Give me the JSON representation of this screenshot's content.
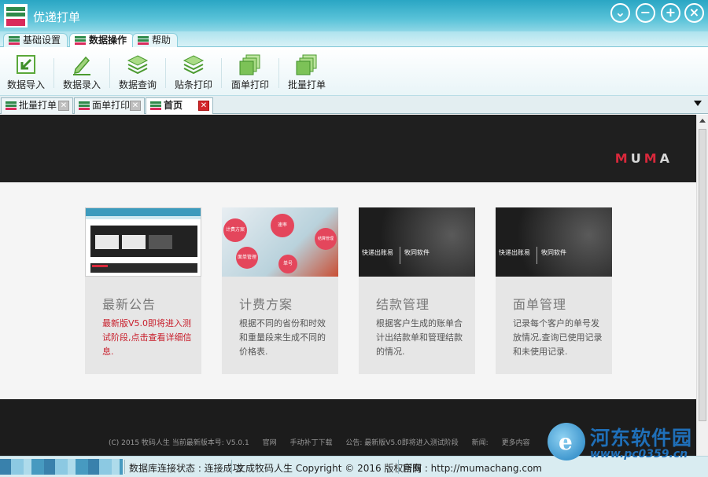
{
  "window": {
    "title": "优递打单"
  },
  "ribbon_tabs": [
    {
      "label": "基础设置"
    },
    {
      "label": "数据操作",
      "active": true
    },
    {
      "label": "帮助"
    }
  ],
  "toolbar": [
    {
      "label": "数据导入",
      "icon": "import-icon"
    },
    {
      "label": "数据录入",
      "icon": "pencil-icon"
    },
    {
      "label": "数据查询",
      "icon": "stack-icon"
    },
    {
      "label": "贴条打印",
      "icon": "stack-icon"
    },
    {
      "label": "面单打印",
      "icon": "pages-icon"
    },
    {
      "label": "批量打单",
      "icon": "pages-icon"
    }
  ],
  "doc_tabs": [
    {
      "label": "批量打单"
    },
    {
      "label": "面单打印"
    },
    {
      "label": "首页",
      "active": true
    }
  ],
  "banner": {
    "logo_text": "MUMA"
  },
  "cards": [
    {
      "title": "最新公告",
      "desc": "最新版V5.0即将进入测试阶段,点击查看详细信息.",
      "highlight": true
    },
    {
      "title": "计费方案",
      "desc": "根据不同的省份和时效和重量段来生成不同的价格表."
    },
    {
      "title": "结款管理",
      "desc": "根据客户生成的账单合计出结款单和管理结款的情况."
    },
    {
      "title": "面单管理",
      "desc": "记录每个客户的单号发放情况,查询已使用记录和未使用记录."
    }
  ],
  "card_thumbs": {
    "thumb3_line1": "快递出账易",
    "thumb3_line2": "牧同软件",
    "thumb4_line1": "快递出账易",
    "thumb4_line2": "牧同软件",
    "bubbles": [
      "计费方案",
      "速率",
      "结算管理",
      "面单管理",
      "单号"
    ]
  },
  "footer": {
    "items": [
      "(C) 2015 牧码人生 当前最新版本号: V5.0.1",
      "官网",
      "手动补丁下载",
      "公告: 最新版V5.0即将进入测试阶段",
      "新闻:",
      "更多内容"
    ]
  },
  "statusbar": {
    "db_status": "数据库连接状态 : 连接成功",
    "copyright": "文成牧码人生 Copyright © 2016 版权所有",
    "website": "官网 : http://mumachang.com"
  },
  "watermark": {
    "name": "河东软件园",
    "url": "www.pc0359.cn"
  },
  "colors": {
    "accent": "#2aa6c4",
    "brand_red": "#d92a5b",
    "brand_green": "#2f8a4a"
  }
}
